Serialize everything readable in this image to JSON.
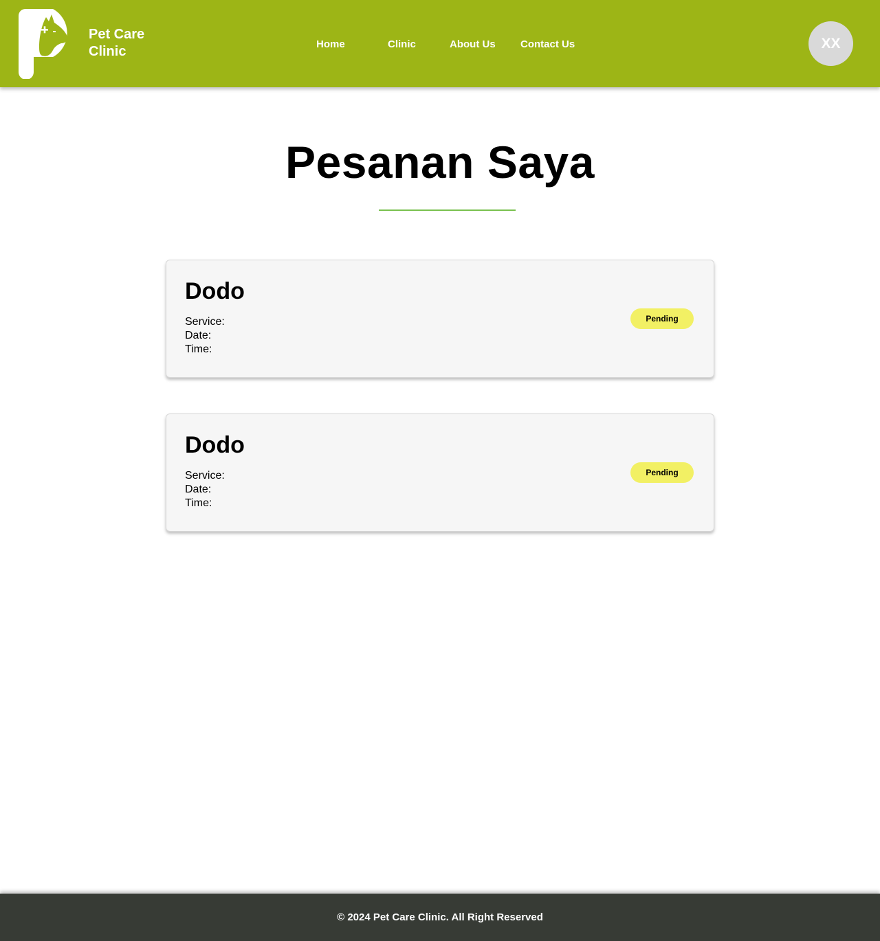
{
  "header": {
    "brand_line1": "Pet Care",
    "brand_line2": "Clinic",
    "nav": [
      "Home",
      "Clinic",
      "About Us",
      "Contact Us"
    ],
    "avatar_initials": "XX"
  },
  "main": {
    "title": "Pesanan Saya",
    "bookings": [
      {
        "pet_name": "Dodo",
        "service_label": "Service:",
        "date_label": "Date:",
        "time_label": "Time:",
        "status": "Pending"
      },
      {
        "pet_name": "Dodo",
        "service_label": "Service:",
        "date_label": "Date:",
        "time_label": "Time:",
        "status": "Pending"
      }
    ]
  },
  "footer": {
    "text": "© 2024 Pet Care Clinic. All Right Reserved"
  },
  "colors": {
    "header_bg": "#9db516",
    "footer_bg": "#373b35",
    "accent_line": "#79c14f",
    "status_pending": "#f2f064",
    "avatar_bg": "#d9d9d9"
  },
  "icons": {
    "logo": "pet-care-clinic-logo"
  }
}
